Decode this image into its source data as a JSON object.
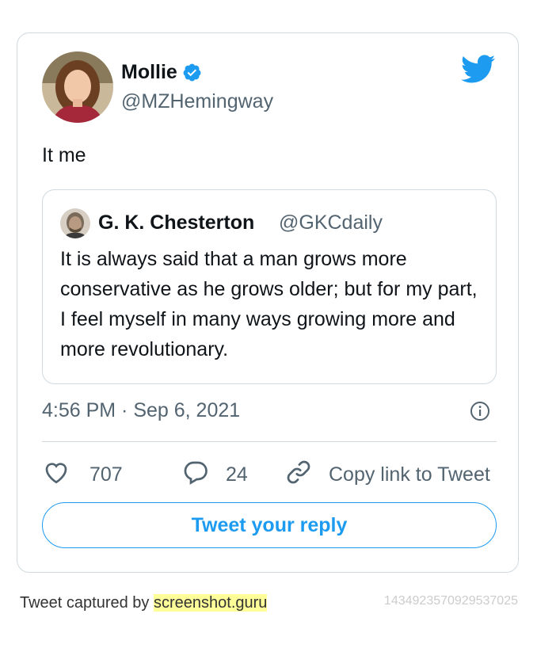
{
  "tweet": {
    "author_name": "Mollie",
    "author_handle": "@MZHemingway",
    "text": "It me",
    "timestamp": "4:56 PM · Sep 6, 2021",
    "likes": "707",
    "replies": "24",
    "copy_link_label": "Copy link to Tweet",
    "reply_button_label": "Tweet your reply"
  },
  "quoted": {
    "author_name": "G. K. Chesterton",
    "author_handle": "@GKCdaily",
    "text": "It is always said that a man grows more conservative as he grows older; but for my part, I feel myself in many ways growing more and more revolutionary."
  },
  "footer": {
    "caption_prefix": "Tweet captured by",
    "caption_link": "screenshot.guru",
    "tweet_id": "1434923570929537025"
  },
  "icons": {
    "brand": "twitter-bird-icon",
    "verified": "verified-badge-icon",
    "info": "info-icon",
    "like": "heart-icon",
    "reply": "speech-bubble-icon",
    "link": "link-icon"
  },
  "colors": {
    "accent": "#1d9bf0",
    "text_primary": "#0f1419",
    "text_secondary": "#536471",
    "border": "#cfd9de",
    "highlight": "#ffff99"
  }
}
